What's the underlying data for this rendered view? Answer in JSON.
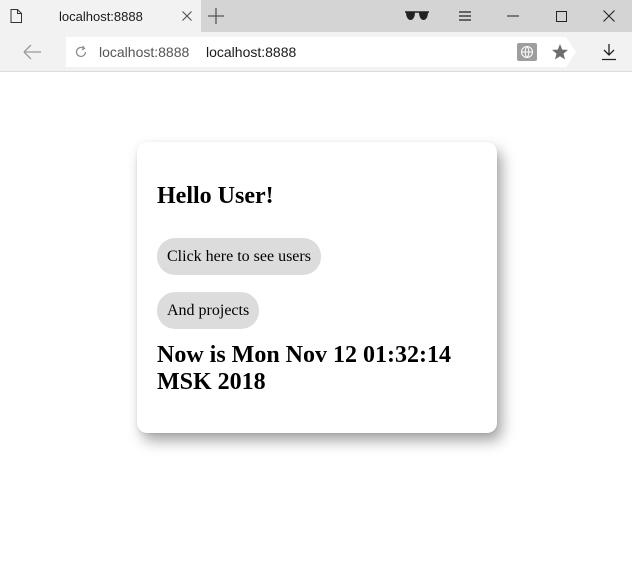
{
  "browser": {
    "tab": {
      "title": "localhost:8888"
    },
    "address": {
      "host": "localhost:8888",
      "text": "localhost:8888"
    }
  },
  "page": {
    "greeting": "Hello User!",
    "users_button": "Click here to see users",
    "projects_button": "And projects",
    "now_text": "Now is Mon Nov 12 01:32:14 MSK 2018"
  },
  "icons": {
    "tab_page": "page-icon",
    "tab_close": "close-icon",
    "new_tab": "plus-icon",
    "incognito": "sunglasses-icon",
    "menu": "hamburger-icon",
    "minimize": "minimize-icon",
    "maximize": "maximize-icon",
    "close_window": "close-icon",
    "back": "arrow-left-icon",
    "reload": "reload-icon",
    "translate": "translate-icon",
    "bookmark": "star-icon",
    "download": "download-icon"
  },
  "colors": {
    "tabstrip": "#d4d4d4",
    "toolbar": "#f2f2f2",
    "button_bg": "#dcdcdc",
    "text": "#000000"
  }
}
